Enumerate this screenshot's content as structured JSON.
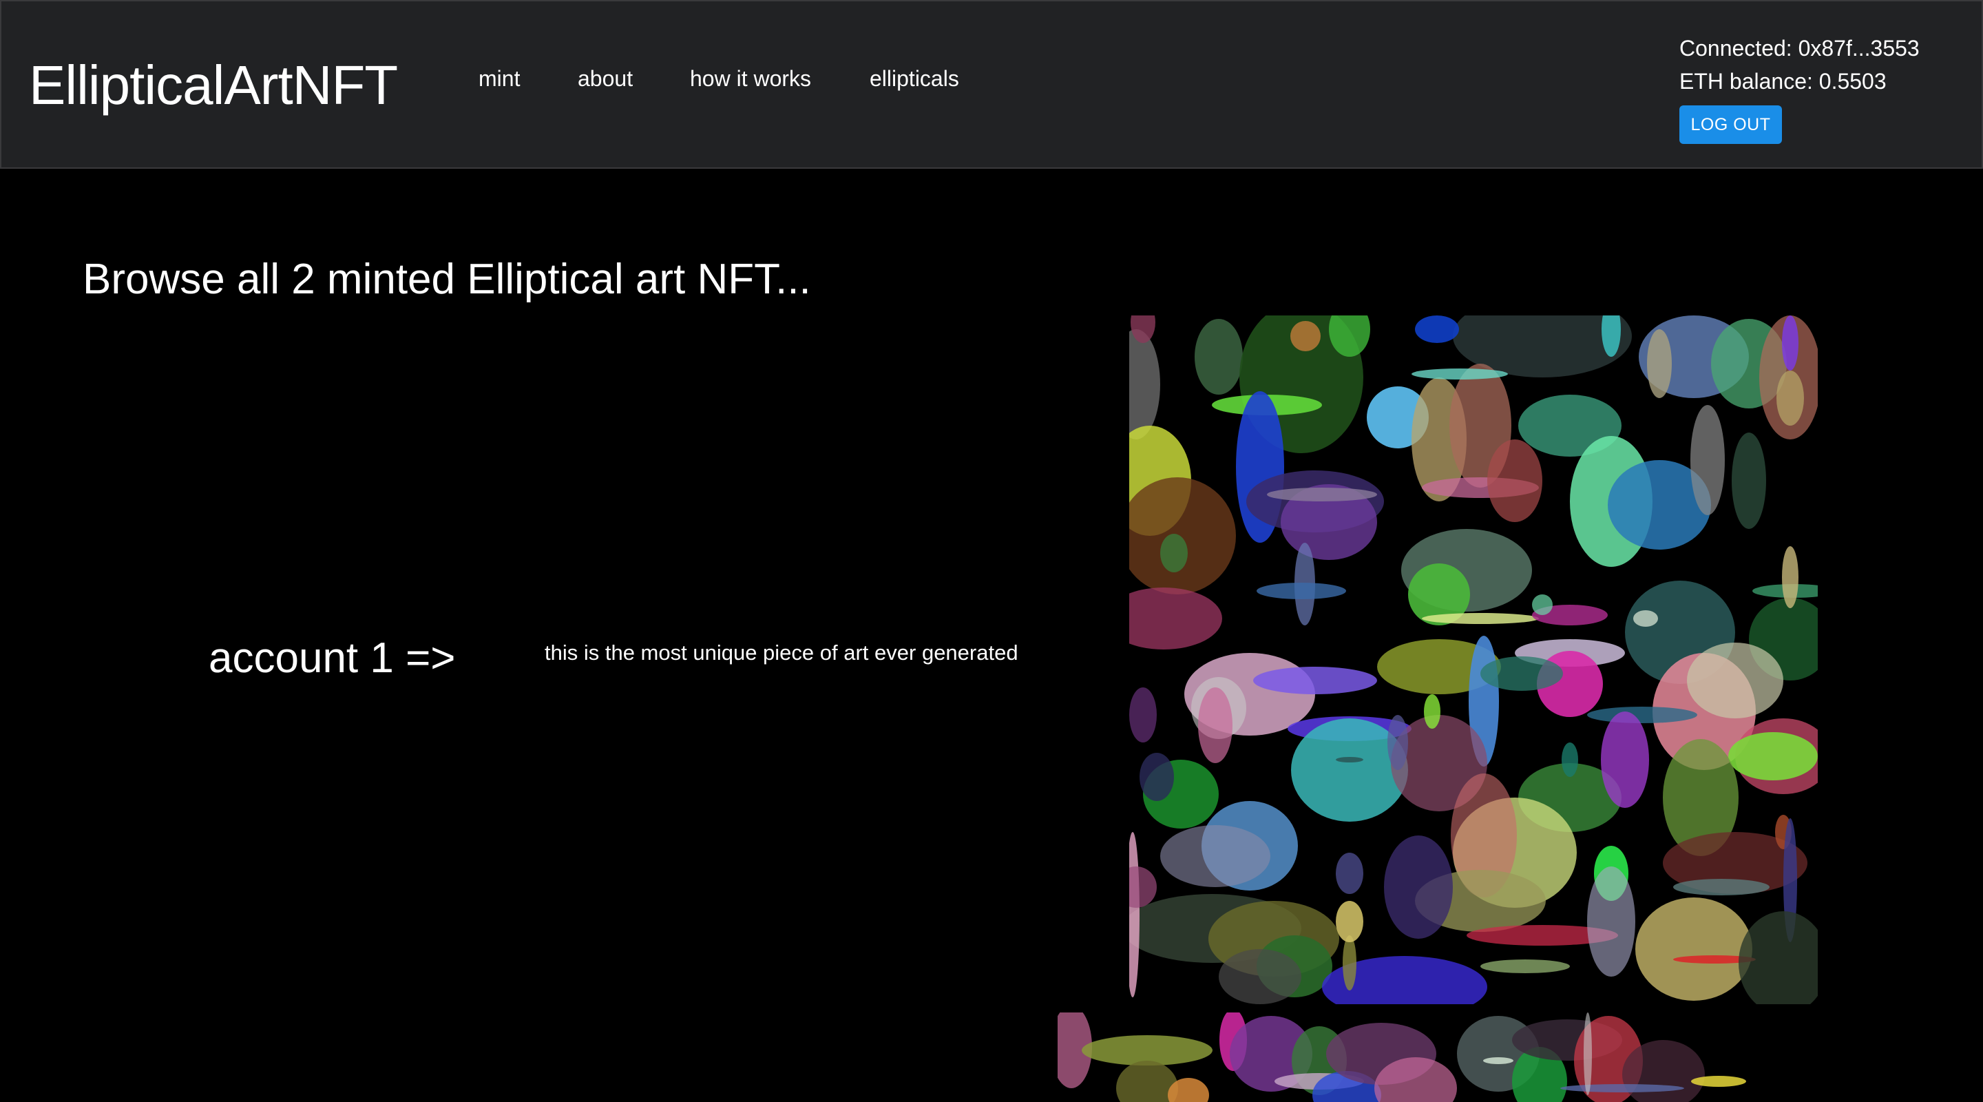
{
  "navbar": {
    "brand": "EllipticalArtNFT",
    "links": [
      {
        "label": "mint"
      },
      {
        "label": "about"
      },
      {
        "label": "how it works"
      },
      {
        "label": "ellipticals"
      }
    ],
    "account": {
      "connected": "Connected: 0x87f...3553",
      "balance": "ETH balance: 0.5503",
      "logout_label": "LOG OUT"
    }
  },
  "main": {
    "heading": "Browse all 2 minted Elliptical art NFT...",
    "items": [
      {
        "owner_label": "account 1 =>",
        "description": "this is the most unique piece of art ever generated"
      }
    ]
  },
  "colors": {
    "navbar_bg": "#212224",
    "page_bg": "#000000",
    "accent": "#1a8ee8"
  }
}
